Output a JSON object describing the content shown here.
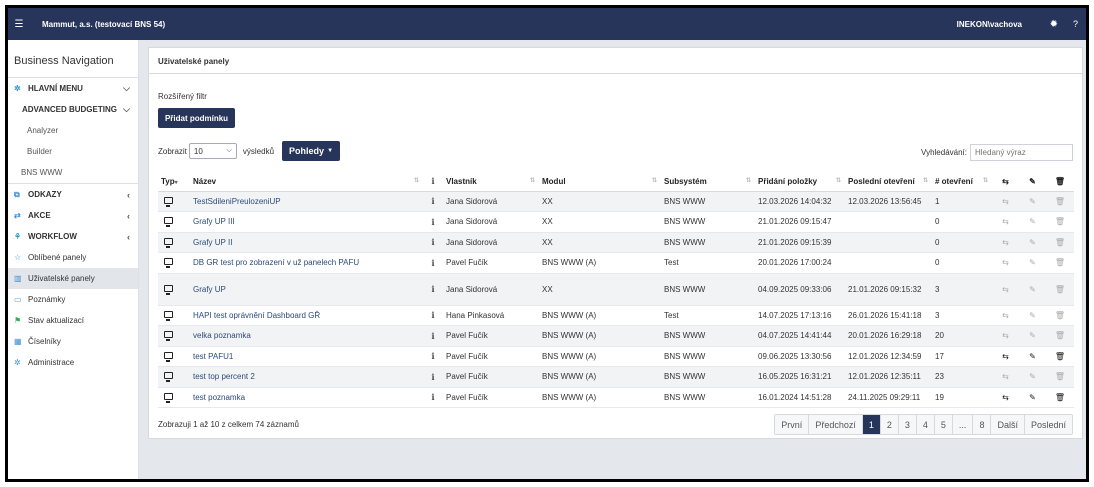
{
  "topbar": {
    "menu_icon": "hamburger-icon",
    "title": "Mammut, a.s. (testovací BNS 54)",
    "user": "INEKON\\vachova",
    "bug_icon": "bug-icon",
    "help": "?"
  },
  "sidebar": {
    "title": "Business Navigation",
    "main_menu": "HLAVNÍ MENU",
    "advanced": "ADVANCED BUDGETING",
    "analyzer": "Analyzer",
    "builder": "Builder",
    "bns_www": "BNS WWW",
    "odkazy": "ODKAZY",
    "akce": "AKCE",
    "workflow": "WORKFLOW",
    "oblibene": "Oblíbené panely",
    "uzivatelske": "Uživatelské panely",
    "poznamky": "Poznámky",
    "stav": "Stav aktualizací",
    "ciselniky": "Číselníky",
    "administrace": "Administrace"
  },
  "panel": {
    "title": "Uživatelské panely",
    "filter_label": "Rozšířený filtr",
    "add_condition": "Přidat podmínku",
    "show_prefix": "Zobrazit",
    "show_value": "10",
    "show_suffix": "výsledků",
    "views_button": "Pohledy",
    "search_label": "Vyhledávání:",
    "search_placeholder": "Hledaný výraz"
  },
  "table": {
    "headers": {
      "typ": "Typ",
      "nazev": "Název",
      "info": "i",
      "vlastnik": "Vlastník",
      "modul": "Modul",
      "subsystem": "Subsystém",
      "pridani": "Přidání položky",
      "otevreni": "Poslední otevření",
      "pocet": "# otevření"
    },
    "rows": [
      {
        "nazev": "TestSdileniPreulozeniUP",
        "info": "i",
        "vlastnik": "Jana Sidorová",
        "modul": "XX",
        "subsystem": "BNS WWW",
        "pridani": "12.03.2026 14:04:32",
        "otevreni": "12.03.2026 13:56:45",
        "pocet": "1",
        "active": false
      },
      {
        "nazev": "Grafy UP III",
        "info": "i",
        "vlastnik": "Jana Sidorová",
        "modul": "XX",
        "subsystem": "BNS WWW",
        "pridani": "21.01.2026 09:15:47",
        "otevreni": "",
        "pocet": "0",
        "active": false
      },
      {
        "nazev": "Grafy UP II",
        "info": "i",
        "vlastnik": "Jana Sidorová",
        "modul": "XX",
        "subsystem": "BNS WWW",
        "pridani": "21.01.2026 09:15:39",
        "otevreni": "",
        "pocet": "0",
        "active": false
      },
      {
        "nazev": "DB GR test pro zobrazení v už panelech PAFU",
        "info": "i",
        "vlastnik": "Pavel Fučík",
        "modul": "BNS WWW (A)",
        "subsystem": "Test",
        "pridani": "20.01.2026 17:00:24",
        "otevreni": "",
        "pocet": "0",
        "active": false
      },
      {
        "nazev": "Grafy UP",
        "info": "i",
        "vlastnik": "Jana Sidorová",
        "modul": "XX",
        "subsystem": "BNS WWW",
        "pridani": "04.09.2025 09:33:06",
        "otevreni": "21.01.2026 09:15:32",
        "pocet": "3",
        "active": false
      },
      {
        "nazev": "HAPI test oprávnění Dashboard GŘ",
        "info": "i",
        "vlastnik": "Hana Pinkasová",
        "modul": "BNS WWW (A)",
        "subsystem": "Test",
        "pridani": "14.07.2025 17:13:16",
        "otevreni": "26.01.2026 15:41:18",
        "pocet": "3",
        "active": false
      },
      {
        "nazev": "velka poznamka",
        "info": "i",
        "vlastnik": "Pavel Fučík",
        "modul": "BNS WWW (A)",
        "subsystem": "BNS WWW",
        "pridani": "04.07.2025 14:41:44",
        "otevreni": "20.01.2026 16:29:18",
        "pocet": "20",
        "active": false
      },
      {
        "nazev": "test PAFU1",
        "info": "i",
        "vlastnik": "Pavel Fučík",
        "modul": "BNS WWW (A)",
        "subsystem": "BNS WWW",
        "pridani": "09.06.2025 13:30:56",
        "otevreni": "12.01.2026 12:34:59",
        "pocet": "17",
        "active": true
      },
      {
        "nazev": "test top percent 2",
        "info": "i",
        "vlastnik": "Pavel Fučík",
        "modul": "BNS WWW (A)",
        "subsystem": "BNS WWW",
        "pridani": "16.05.2025 16:31:21",
        "otevreni": "12.01.2026 12:35:11",
        "pocet": "23",
        "active": false
      },
      {
        "nazev": "test poznamka",
        "info": "i",
        "vlastnik": "Pavel Fučík",
        "modul": "BNS WWW (A)",
        "subsystem": "BNS WWW",
        "pridani": "16.01.2024 14:51:28",
        "otevreni": "24.11.2025 09:29:11",
        "pocet": "19",
        "active": true
      }
    ]
  },
  "footer": {
    "summary": "Zobrazuji 1 až 10 z celkem 74 záznamů",
    "pages": [
      "První",
      "Předchozí",
      "1",
      "2",
      "3",
      "4",
      "5",
      "...",
      "8",
      "Další",
      "Poslední"
    ],
    "current_page": "1"
  }
}
